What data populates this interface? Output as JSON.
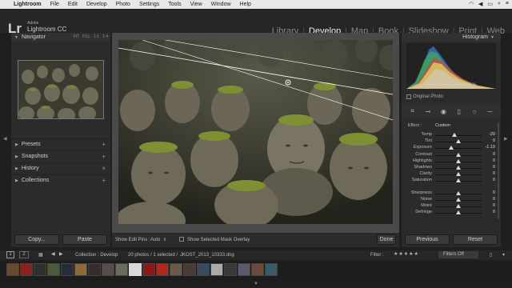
{
  "menubar": {
    "app": "Lightroom",
    "items": [
      "File",
      "Edit",
      "Develop",
      "Photo",
      "Settings",
      "Tools",
      "View",
      "Window",
      "Help"
    ]
  },
  "identity": {
    "logo": "Lr",
    "adobe": "Adobe",
    "product": "Lightroom CC"
  },
  "modules": [
    "Library",
    "Develop",
    "Map",
    "Book",
    "Slideshow",
    "Print",
    "Web"
  ],
  "active_module": "Develop",
  "left_panel": {
    "navigator": {
      "title": "Navigator",
      "zoom_options": [
        "FIT",
        "FILL",
        "1:1",
        "1:4"
      ]
    },
    "sections": [
      {
        "label": "Presets",
        "action": "+"
      },
      {
        "label": "Snapshots",
        "action": "+"
      },
      {
        "label": "History",
        "action": "×"
      },
      {
        "label": "Collections",
        "action": "+"
      }
    ],
    "copy_button": "Copy...",
    "paste_button": "Paste"
  },
  "toolbar": {
    "show_edit_pins_label": "Show Edit Pins :",
    "show_edit_pins_value": "Auto",
    "mask_overlay_label": "Show Selected Mask Overlay",
    "done_button": "Done"
  },
  "right_panel": {
    "histogram_title": "Histogram",
    "rgb_readout": "R  53.8  G  52.0  B  48.8 %",
    "original_photo_label": "Original Photo",
    "effect_label": "Effect :",
    "effect_value": "Custom",
    "sliders": [
      {
        "label": "Temp",
        "value": "-20",
        "pos": 0.42
      },
      {
        "label": "Tint",
        "value": "0",
        "pos": 0.5
      },
      {
        "label": "Exposure",
        "value": "-1.19",
        "pos": 0.35
      },
      {
        "label": "Contrast",
        "value": "0",
        "pos": 0.5
      },
      {
        "label": "Highlights",
        "value": "0",
        "pos": 0.5
      },
      {
        "label": "Shadows",
        "value": "0",
        "pos": 0.5
      },
      {
        "label": "Clarity",
        "value": "0",
        "pos": 0.5
      },
      {
        "label": "Saturation",
        "value": "0",
        "pos": 0.5
      },
      {
        "label": "Sharpness",
        "value": "0",
        "pos": 0.5
      },
      {
        "label": "Noise",
        "value": "0",
        "pos": 0.5
      },
      {
        "label": "Moiré",
        "value": "0",
        "pos": 0.5
      },
      {
        "label": "Defringe",
        "value": "0",
        "pos": 0.5
      }
    ],
    "previous_button": "Previous",
    "reset_button": "Reset"
  },
  "filmstrip_bar": {
    "view1": "1",
    "view2": "2",
    "collection": "Collection : Develop",
    "count": "20 photos / 1 selected /",
    "filename": "JKOST_2013_10333.dng",
    "filter_label": "Filter :",
    "filters_off": "Filters Off"
  },
  "filmstrip": {
    "thumbnail_colors": [
      "#6b4a2a",
      "#8a2222",
      "#2f2f2f",
      "#4a5a3a",
      "#2a2a3a",
      "#8b6b3b",
      "#3a2a2a",
      "#5a4a4a",
      "#6b6b5a",
      "#d9d9d9",
      "#8a1a1a",
      "#b0281a",
      "#6a5a4a",
      "#4a3a3a",
      "#3a4a5a",
      "#aaaaaa",
      "#3a3a3a",
      "#5a5a6a",
      "#6a4a3a",
      "#3a5a6a"
    ],
    "selected_index": 9
  }
}
